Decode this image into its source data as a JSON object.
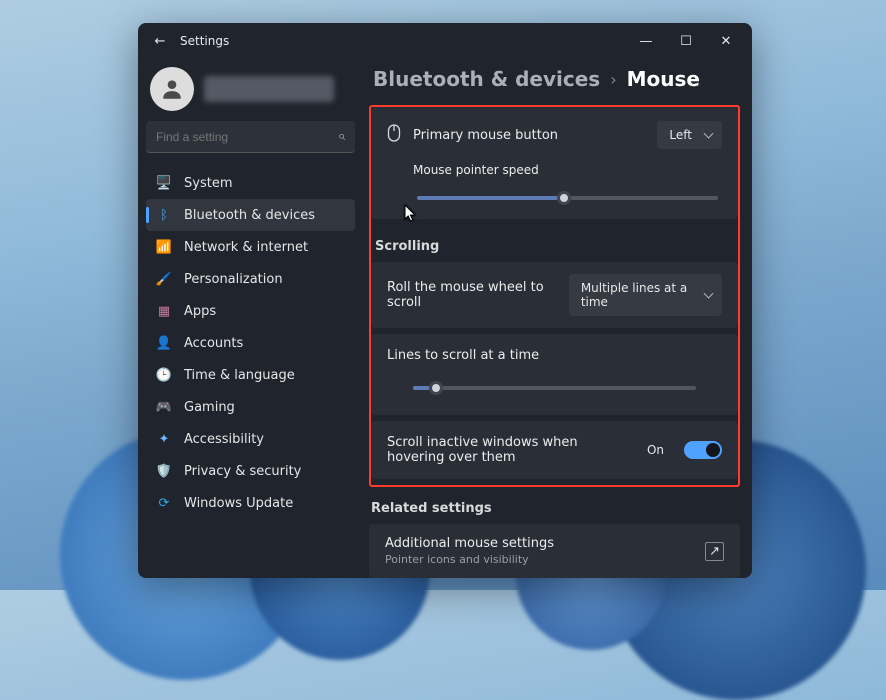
{
  "app_title": "Settings",
  "window_controls": {
    "min": "—",
    "max": "☐",
    "close": "✕"
  },
  "back_glyph": "←",
  "search": {
    "placeholder": "Find a setting",
    "icon": "⌕"
  },
  "nav_items": [
    {
      "icon": "🖥️",
      "label": "System"
    },
    {
      "icon": "ᛒ",
      "label": "Bluetooth & devices",
      "active": true,
      "icon_color": "#4fa3ff"
    },
    {
      "icon": "📶",
      "label": "Network & internet",
      "icon_color": "#4fc6ff"
    },
    {
      "icon": "🖌️",
      "label": "Personalization"
    },
    {
      "icon": "▦",
      "label": "Apps",
      "icon_color": "#c77a9b"
    },
    {
      "icon": "👤",
      "label": "Accounts"
    },
    {
      "icon": "🕒",
      "label": "Time & language"
    },
    {
      "icon": "🎮",
      "label": "Gaming"
    },
    {
      "icon": "✦",
      "label": "Accessibility",
      "icon_color": "#6ab8ff"
    },
    {
      "icon": "🛡️",
      "label": "Privacy & security"
    },
    {
      "icon": "⟳",
      "label": "Windows Update",
      "icon_color": "#2fa8e4"
    }
  ],
  "breadcrumb": {
    "parent": "Bluetooth & devices",
    "current": "Mouse",
    "sep": "›"
  },
  "primary_button": {
    "label": "Primary mouse button",
    "value": "Left"
  },
  "pointer_speed": {
    "label": "Mouse pointer speed",
    "pct": 49
  },
  "scrolling_header": "Scrolling",
  "wheel_mode": {
    "label": "Roll the mouse wheel to scroll",
    "value": "Multiple lines at a time"
  },
  "lines_at_time": {
    "label": "Lines to scroll at a time",
    "pct": 8
  },
  "inactive_scroll": {
    "label": "Scroll inactive windows when hovering over them",
    "state": "On"
  },
  "related_header": "Related settings",
  "additional": {
    "title": "Additional mouse settings",
    "sub": "Pointer icons and visibility",
    "launch": "↗"
  },
  "colors": {
    "highlight": "#ff3b2f",
    "accent": "#4fa3ff"
  }
}
